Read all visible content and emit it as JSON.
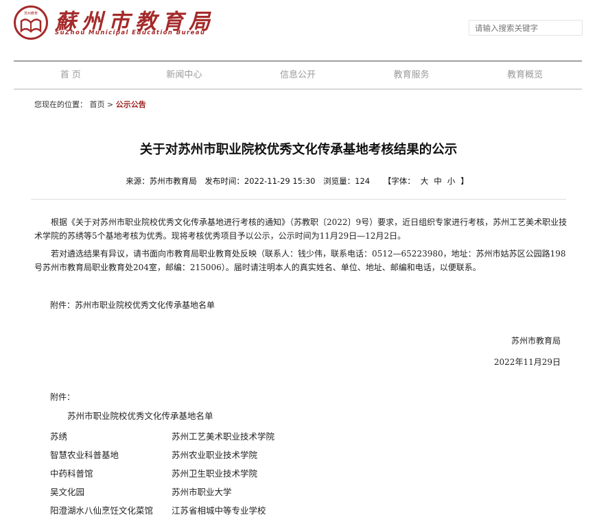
{
  "header": {
    "logo_small_text": "苏州教育",
    "logo_cn": "蘇州市教育局",
    "logo_en": "SuZhou Municipal Education Bureau",
    "search_placeholder": "请输入搜索关键字"
  },
  "nav": {
    "items": [
      {
        "label": "首 页"
      },
      {
        "label": "新闻中心"
      },
      {
        "label": "信息公开"
      },
      {
        "label": "教育服务"
      },
      {
        "label": "教育概览"
      }
    ]
  },
  "breadcrumb": {
    "prefix": "您现在的位置：",
    "home": "首页",
    "sep": ">",
    "current": "公示公告"
  },
  "article": {
    "title": "关于对苏州市职业院校优秀文化传承基地考核结果的公示",
    "meta": {
      "source": "来源：苏州市教育局",
      "published": "发布时间：2022-11-29 15:30",
      "views": "浏览量：124",
      "font_prefix": "【字体：",
      "font_large": "大",
      "font_medium": "中",
      "font_small": "小",
      "font_suffix": "】"
    },
    "paragraphs": [
      "根据《关于对苏州市职业院校优秀文化传承基地进行考核的通知》（苏教职〔2022〕9号）要求，近日组织专家进行考核，苏州工艺美术职业技术学院的苏绣等5个基地考核为优秀。现将考核优秀项目予以公示，公示时间为11月29日—12月2日。",
      "若对遴选结果有异议，请书面向市教育局职业教育处反映（联系人：钱少伟，联系电话：0512—65223980，地址：苏州市姑苏区公园路198号苏州市教育局职业教育处204室，邮编：215006）。届时请注明本人的真实姓名、单位、地址、邮编和电话，以便联系。"
    ],
    "attachment": "附件：苏州市职业院校优秀文化传承基地名单",
    "signature_org": "苏州市教育局",
    "signature_date": "2022年11月29日",
    "annex_label": "附件：",
    "annex_title": "苏州市职业院校优秀文化传承基地名单",
    "annex_rows": [
      {
        "base": "苏绣",
        "school": "苏州工艺美术职业技术学院"
      },
      {
        "base": "智慧农业科普基地",
        "school": "苏州农业职业技术学院"
      },
      {
        "base": "中药科普馆",
        "school": "苏州卫生职业技术学院"
      },
      {
        "base": "吴文化园",
        "school": "苏州市职业大学"
      },
      {
        "base": "阳澄湖水八仙烹饪文化菜馆",
        "school": "江苏省相城中等专业学校"
      }
    ]
  }
}
